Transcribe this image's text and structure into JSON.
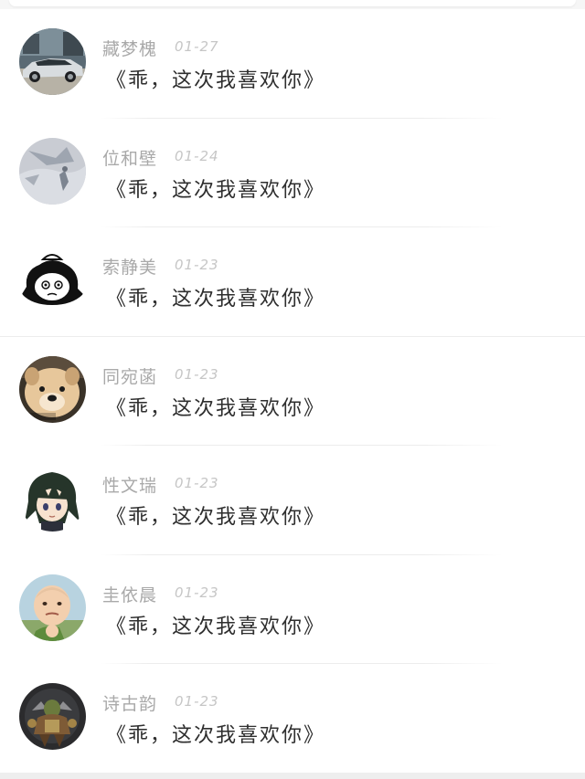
{
  "comments": [
    {
      "author": "藏梦槐",
      "date": "01-27",
      "text": "《乖，这次我喜欢你》",
      "avatar": "car-avatar-icon"
    },
    {
      "author": "位和壁",
      "date": "01-24",
      "text": "《乖，这次我喜欢你》",
      "avatar": "sky-figure-avatar-icon"
    },
    {
      "author": "索静美",
      "date": "01-23",
      "text": "《乖，这次我喜欢你》",
      "avatar": "cartoon-face-avatar-icon"
    },
    {
      "author": "同宛菡",
      "date": "01-23",
      "text": "《乖，这次我喜欢你》",
      "avatar": "puppy-avatar-icon"
    },
    {
      "author": "性文瑞",
      "date": "01-23",
      "text": "《乖，这次我喜欢你》",
      "avatar": "anime-character-avatar-icon"
    },
    {
      "author": "圭依晨",
      "date": "01-23",
      "text": "《乖，这次我喜欢你》",
      "avatar": "baby-avatar-icon"
    },
    {
      "author": "诗古韵",
      "date": "01-23",
      "text": "《乖，这次我喜欢你》",
      "avatar": "warrior-avatar-icon"
    }
  ],
  "colors": {
    "author": "#a9a9a9",
    "date": "#c6c6c6",
    "message": "#2e2e2e",
    "background": "#ffffff"
  }
}
